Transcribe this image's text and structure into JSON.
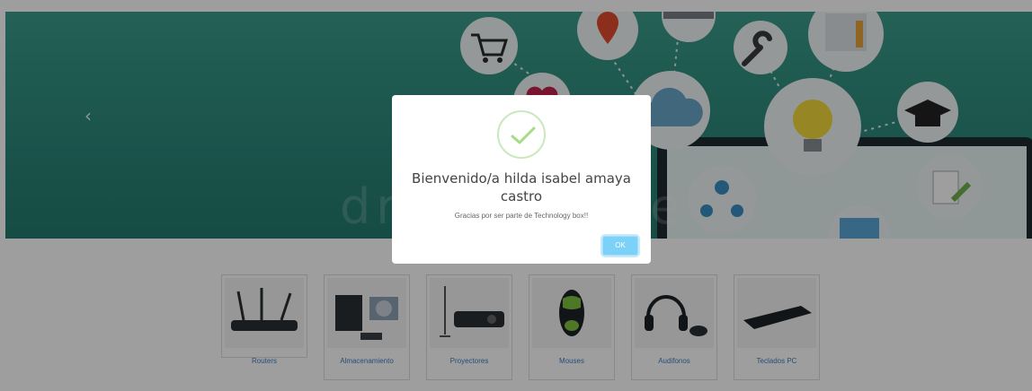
{
  "carousel": {
    "prev_arrow": "‹",
    "watermark": "dreamstime"
  },
  "products": [
    {
      "label": "Routers",
      "icon": "router-icon"
    },
    {
      "label": "Almacenamiento",
      "icon": "hard-drive-icon"
    },
    {
      "label": "Proyectores",
      "icon": "projector-icon"
    },
    {
      "label": "Mouses",
      "icon": "mouse-icon"
    },
    {
      "label": "Audifonos",
      "icon": "headphones-icon"
    },
    {
      "label": "Teclados PC",
      "icon": "keyboard-icon"
    }
  ],
  "modal": {
    "title": "Bienvenido/a hilda isabel amaya castro",
    "text": "Gracias por ser parte de Technology box!!",
    "ok_label": "OK",
    "icon": "checkmark-icon"
  },
  "colors": {
    "banner": "#2e8c7e",
    "ok_button": "#7cd1f9",
    "product_label": "#3a7fc4",
    "success_ring": "#c9e8bd",
    "success_check": "#a5dc86"
  }
}
